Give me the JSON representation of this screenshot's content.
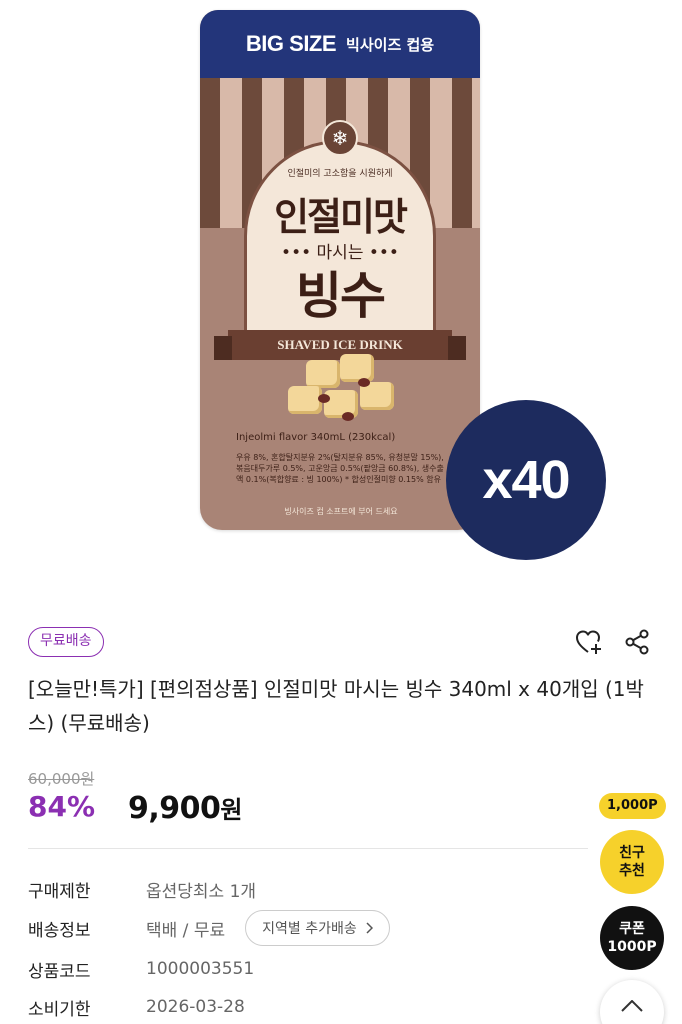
{
  "product_image": {
    "pouch_top_big": "BIG SIZE",
    "pouch_top_kor": "빅사이즈 컵용",
    "badge_subtitle": "인절미의 고소함을 시원하게",
    "badge_title_1": "인절미맛",
    "badge_title_2": "••• 마시는 •••",
    "badge_title_3": "빙수",
    "ribbon_text": "SHAVED ICE DRINK",
    "flavor_line": "Injeolmi flavor  340mL (230kcal)",
    "ingredients": "우유 8%, 혼합탈지분유 2%(탈지분유 85%, 유청분말 15%), 볶음대두가루 0.5%, 고운앙금 0.5%(팥앙금 60.8%), 생수출액 0.1%(복합향료 : 빙 100%) * 합성인절미향 0.15% 함유",
    "pouch_bottom_text": "빙사이즈 컵 소프트에 부어 드세요",
    "quantity_badge": "x40",
    "colors": {
      "pouch_top": "#23357a",
      "pouch_body": "#a98476",
      "quantity_badge": "#1d2b5e"
    }
  },
  "shipping_badge": "무료배송",
  "actions": {
    "wishlist_icon": "heart-plus-icon",
    "share_icon": "share-icon"
  },
  "title": "[오늘만!특가] [편의점상품] 인절미맛 마시는 빙수 340ml x 40개입 (1박스) (무료배송)",
  "price": {
    "original": "60,000원",
    "discount_rate": "84%",
    "sale_amount": "9,900",
    "sale_unit": "원"
  },
  "info": {
    "purchase_limit_label": "구매제한",
    "purchase_limit_value": "옵션당최소 1개",
    "delivery_label": "배송정보",
    "delivery_value": "택배 / 무료",
    "region_button": "지역별 추가배송",
    "code_label": "상품코드",
    "code_value": "1000003551",
    "expiry_label": "소비기한",
    "expiry_value": "2026-03-28"
  },
  "floating": {
    "points_tag": "1,000P",
    "friend_line1": "친구",
    "friend_line2": "추천",
    "coupon_line1": "쿠폰",
    "coupon_line2": "1000P"
  },
  "accent_color": "#8b2fb2"
}
